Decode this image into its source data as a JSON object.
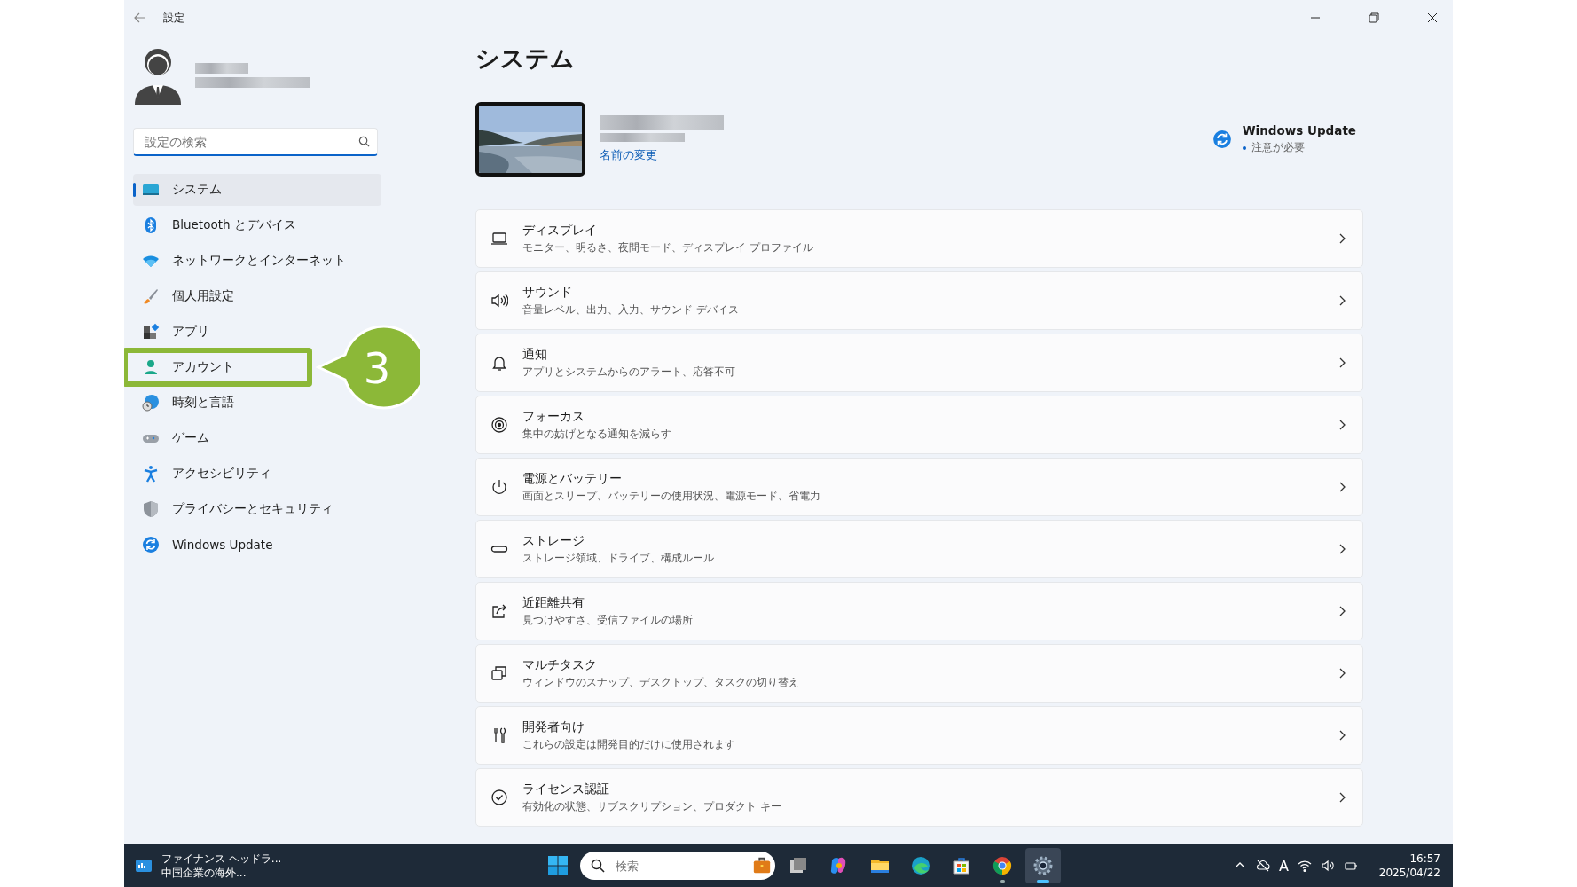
{
  "window": {
    "title": "設定"
  },
  "search": {
    "placeholder": "設定の検索"
  },
  "sidebar": {
    "items": [
      {
        "label": "システム",
        "selected": true
      },
      {
        "label": "Bluetooth とデバイス",
        "selected": false
      },
      {
        "label": "ネットワークとインターネット",
        "selected": false
      },
      {
        "label": "個人用設定",
        "selected": false
      },
      {
        "label": "アプリ",
        "selected": false
      },
      {
        "label": "アカウント",
        "selected": false,
        "callout": "3"
      },
      {
        "label": "時刻と言語",
        "selected": false
      },
      {
        "label": "ゲーム",
        "selected": false
      },
      {
        "label": "アクセシビリティ",
        "selected": false
      },
      {
        "label": "プライバシーとセキュリティ",
        "selected": false
      },
      {
        "label": "Windows Update",
        "selected": false
      }
    ]
  },
  "page": {
    "title": "システム",
    "device": {
      "rename_link": "名前の変更"
    },
    "update": {
      "title": "Windows Update",
      "status": "注意が必要"
    },
    "rows": [
      {
        "title": "ディスプレイ",
        "subtitle": "モニター、明るさ、夜間モード、ディスプレイ プロファイル"
      },
      {
        "title": "サウンド",
        "subtitle": "音量レベル、出力、入力、サウンド デバイス"
      },
      {
        "title": "通知",
        "subtitle": "アプリとシステムからのアラート、応答不可"
      },
      {
        "title": "フォーカス",
        "subtitle": "集中の妨げとなる通知を減らす"
      },
      {
        "title": "電源とバッテリー",
        "subtitle": "画面とスリープ、バッテリーの使用状況、電源モード、省電力"
      },
      {
        "title": "ストレージ",
        "subtitle": "ストレージ領域、ドライブ、構成ルール"
      },
      {
        "title": "近距離共有",
        "subtitle": "見つけやすさ、受信ファイルの場所"
      },
      {
        "title": "マルチタスク",
        "subtitle": "ウィンドウのスナップ、デスクトップ、タスクの切り替え"
      },
      {
        "title": "開発者向け",
        "subtitle": "これらの設定は開発目的だけに使用されます"
      },
      {
        "title": "ライセンス認証",
        "subtitle": "有効化の状態、サブスクリプション、プロダクト キー"
      }
    ]
  },
  "taskbar": {
    "widget": {
      "headline": "ファイナンス ヘッドラ...",
      "detail": "中国企業の海外..."
    },
    "search": {
      "placeholder": "検索"
    },
    "apps": [
      {
        "running": false,
        "active": false
      },
      {
        "running": false,
        "active": false
      },
      {
        "running": false,
        "active": false
      },
      {
        "running": false,
        "active": false
      },
      {
        "running": false,
        "active": false
      },
      {
        "running": true,
        "active": false
      },
      {
        "running": true,
        "active": true
      }
    ],
    "ime": "A",
    "time": "16:57",
    "date": "2025/04/22"
  }
}
